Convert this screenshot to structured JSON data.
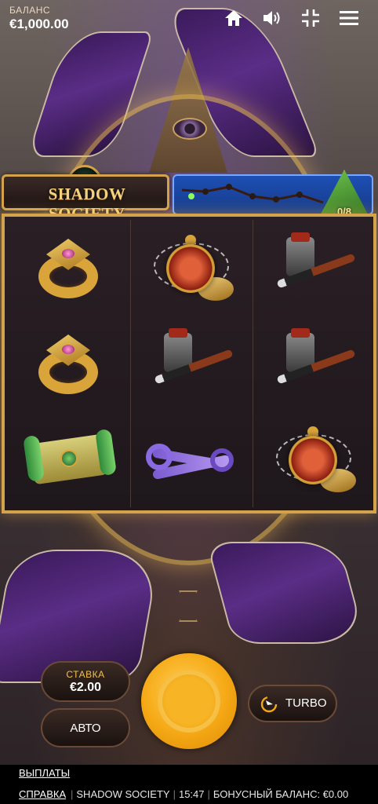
{
  "balance": {
    "label": "БАЛАНС",
    "value": "€1,000.00"
  },
  "topbar": {
    "icons": [
      "home-icon",
      "sound-icon",
      "collapse-icon",
      "menu-icon"
    ]
  },
  "game": {
    "logo_text": "SHADOW SOCIETY",
    "progress": {
      "collected": 0,
      "total": 8,
      "label": "0/8"
    }
  },
  "reels": {
    "columns": [
      [
        "gold-ring",
        "gold-ring",
        "green-scroll"
      ],
      [
        "pocket-watch",
        "ink-and-pen",
        "purple-keys"
      ],
      [
        "ink-and-pen",
        "ink-and-pen",
        "pocket-watch"
      ]
    ]
  },
  "controls": {
    "bet_label": "СТАВКА",
    "bet_value": "€2.00",
    "auto_label": "АВТО",
    "turbo_label": "TURBO"
  },
  "footer": {
    "payouts_link": "ВЫПЛАТЫ",
    "help_link": "СПРАВКА",
    "game_name": "SHADOW SOCIETY",
    "time": "15:47",
    "bonus_balance": "БОНУСНЫЙ БАЛАНС: €0.00"
  },
  "colors": {
    "accent": "#d4a24a",
    "spin": "#f5a814",
    "banner": "#1d4fb4"
  }
}
